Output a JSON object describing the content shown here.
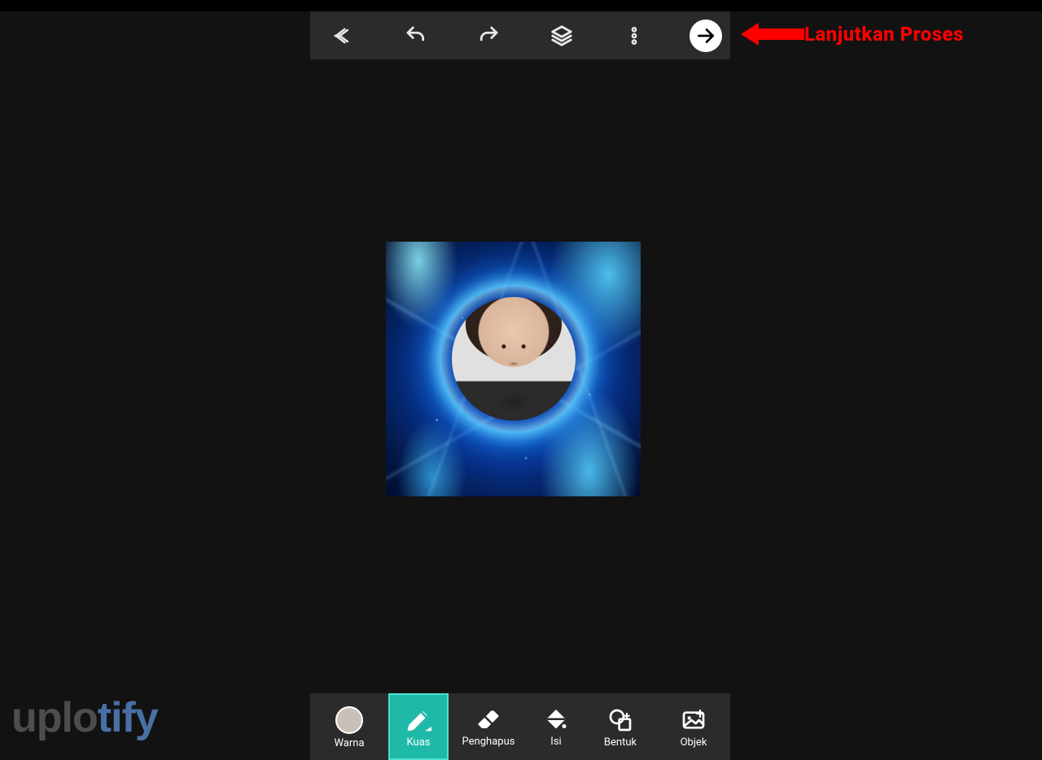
{
  "annotation": {
    "text": "Lanjutkan Proses"
  },
  "toolbar_top": {
    "back_icon": "back-arrow",
    "undo_icon": "undo",
    "redo_icon": "redo",
    "layers_icon": "layers",
    "more_icon": "more-vertical",
    "continue_icon": "arrow-right"
  },
  "canvas": {
    "content_description": "Portrait photo inside glowing blue flame circular frame on digital tech background"
  },
  "toolbar_bottom": {
    "active_color_hex": "#C9C1B8",
    "tools": {
      "color": {
        "label": "Warna"
      },
      "brush": {
        "label": "Kuas",
        "active": true
      },
      "eraser": {
        "label": "Penghapus"
      },
      "fill": {
        "label": "Isi"
      },
      "shape": {
        "label": "Bentuk"
      },
      "object": {
        "label": "Objek"
      }
    }
  },
  "watermark": {
    "part1": "uplo",
    "part2": "tify"
  }
}
